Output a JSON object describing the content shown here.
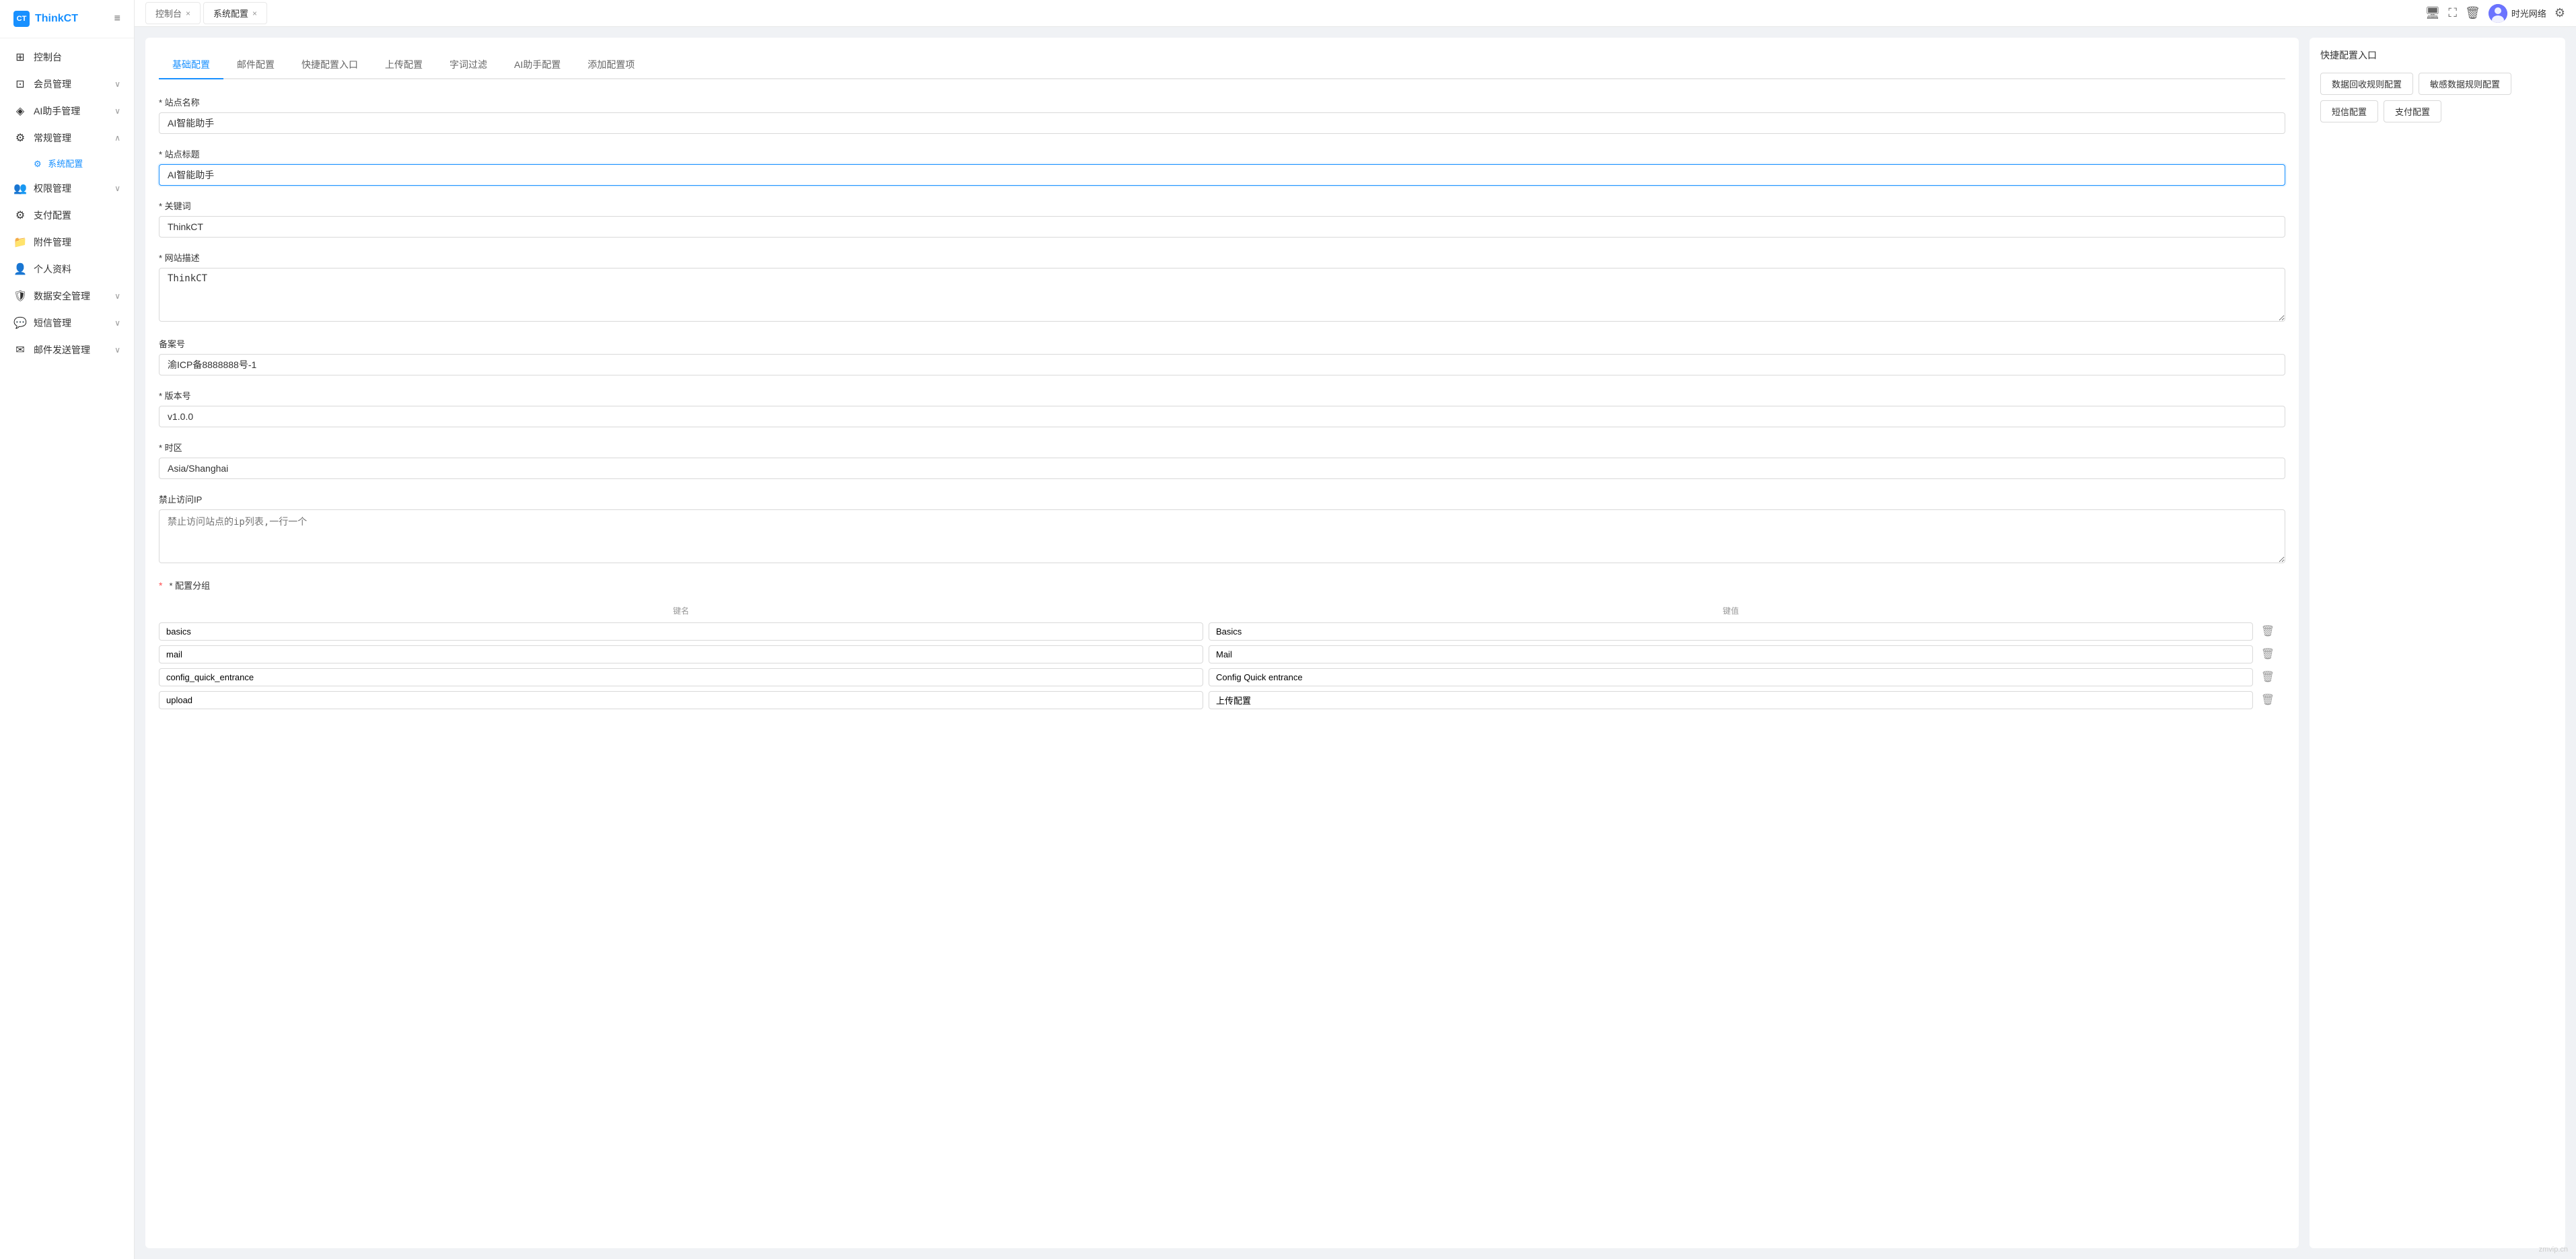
{
  "app": {
    "logo_text": "ThinkCT",
    "logo_abbr": "CT"
  },
  "sidebar": {
    "toggle_icon": "≡",
    "items": [
      {
        "id": "dashboard",
        "label": "控制台",
        "icon": "⊞",
        "expandable": false
      },
      {
        "id": "member",
        "label": "会员管理",
        "icon": "⊡",
        "expandable": true
      },
      {
        "id": "ai",
        "label": "AI助手管理",
        "icon": "◈",
        "expandable": true
      },
      {
        "id": "general",
        "label": "常规管理",
        "icon": "⚙",
        "expandable": true,
        "expanded": true
      },
      {
        "id": "permission",
        "label": "权限管理",
        "icon": "👥",
        "expandable": true
      },
      {
        "id": "payment",
        "label": "支付配置",
        "icon": "⚙",
        "expandable": false
      },
      {
        "id": "attachment",
        "label": "附件管理",
        "icon": "📁",
        "expandable": false
      },
      {
        "id": "profile",
        "label": "个人资料",
        "icon": "👤",
        "expandable": false
      },
      {
        "id": "data_security",
        "label": "数据安全管理",
        "icon": "🛡",
        "expandable": true
      },
      {
        "id": "sms",
        "label": "短信管理",
        "icon": "💬",
        "expandable": true
      },
      {
        "id": "email",
        "label": "邮件发送管理",
        "icon": "✉",
        "expandable": true
      }
    ],
    "submenu_items": [
      {
        "id": "system_config",
        "label": "系统配置",
        "active": true
      }
    ]
  },
  "tabs_bar": {
    "tabs": [
      {
        "id": "dashboard_tab",
        "label": "控制台",
        "closable": true
      },
      {
        "id": "system_config_tab",
        "label": "系统配置",
        "closable": true,
        "active": true
      }
    ]
  },
  "top_right": {
    "monitor_icon": "🖥",
    "expand_icon": "⛶",
    "delete_icon": "🗑",
    "user_name": "时光网络",
    "settings_icon": "⚙"
  },
  "inner_tabs": [
    {
      "id": "basic",
      "label": "基础配置",
      "active": true
    },
    {
      "id": "mail",
      "label": "邮件配置"
    },
    {
      "id": "quick_entrance",
      "label": "快捷配置入口"
    },
    {
      "id": "upload",
      "label": "上传配置"
    },
    {
      "id": "word_filter",
      "label": "字词过滤"
    },
    {
      "id": "ai_assistant",
      "label": "AI助手配置"
    },
    {
      "id": "add_config",
      "label": "添加配置项"
    }
  ],
  "form": {
    "site_name_label": "* 站点名称",
    "site_name_value": "AI智能助手",
    "site_title_label": "* 站点标题",
    "site_title_value": "AI智能助手",
    "keyword_label": "* 关键词",
    "keyword_value": "ThinkCT",
    "description_label": "* 网站描述",
    "description_value": "ThinkCT",
    "icp_label": "备案号",
    "icp_value": "渝ICP备8888888号-1",
    "version_label": "* 版本号",
    "version_value": "v1.0.0",
    "timezone_label": "* 时区",
    "timezone_value": "Asia/Shanghai",
    "banned_ip_label": "禁止访问IP",
    "banned_ip_placeholder": "禁止访问站点的ip列表,一行一个",
    "banned_ip_value": "",
    "config_group_label": "* 配置分组",
    "col_key_label": "键名",
    "col_value_label": "键值",
    "config_rows": [
      {
        "key": "basics",
        "value": "Basics"
      },
      {
        "key": "mail",
        "value": "Mail"
      },
      {
        "key": "config_quick_entrance",
        "value": "Config Quick entrance"
      },
      {
        "key": "upload",
        "value": "上传配置"
      }
    ]
  },
  "right_panel": {
    "title": "快捷配置入口",
    "links": [
      {
        "id": "data_receive",
        "label": "数据回收规则配置"
      },
      {
        "id": "sensitive_data",
        "label": "敏感数据规则配置"
      },
      {
        "id": "sms_config",
        "label": "短信配置"
      },
      {
        "id": "payment_config",
        "label": "支付配置"
      }
    ]
  },
  "watermark": "zmvip.cn"
}
